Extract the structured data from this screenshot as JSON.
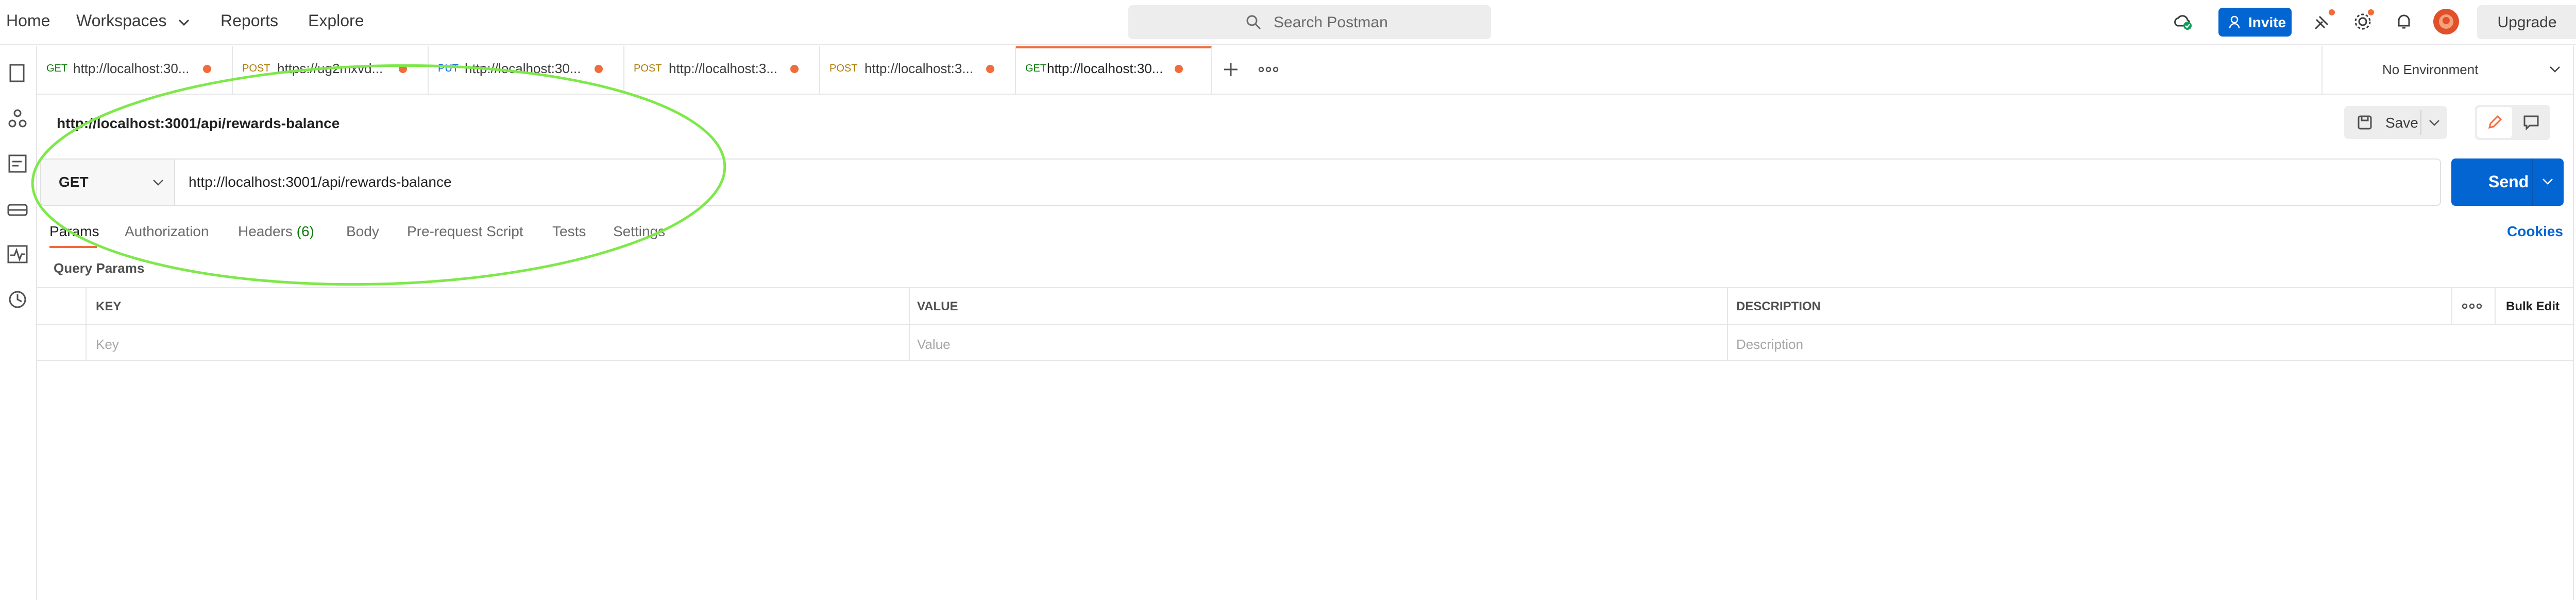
{
  "header": {
    "nav": [
      "Home",
      "Workspaces",
      "Reports",
      "Explore"
    ],
    "search_placeholder": "Search Postman",
    "invite_label": "Invite",
    "upgrade_label": "Upgrade",
    "icons": [
      "cloud-sync-icon",
      "satellite-icon",
      "gear-icon",
      "bell-icon",
      "avatar"
    ]
  },
  "sidebar": {
    "icons": [
      "collections-icon",
      "apis-icon",
      "environments-icon",
      "mock-servers-icon",
      "monitors-icon",
      "history-icon"
    ]
  },
  "tabs": [
    {
      "method": "GET",
      "url": "http://localhost:30...",
      "method_color": "#0f7b0f"
    },
    {
      "method": "POST",
      "url": "https://ug2mxvd...",
      "method_color": "#ad7a03"
    },
    {
      "method": "PUT",
      "url": "http://localhost:30...",
      "method_color": "#0265d2"
    },
    {
      "method": "POST",
      "url": "http://localhost:3...",
      "method_color": "#ad7a03"
    },
    {
      "method": "POST",
      "url": "http://localhost:3...",
      "method_color": "#ad7a03"
    },
    {
      "method": "GET",
      "url": "http://localhost:30...",
      "method_color": "#0f7b0f"
    }
  ],
  "environment": "No Environment",
  "request": {
    "title": "http://localhost:3001/api/rewards-balance",
    "save_label": "Save",
    "method": "GET",
    "url": "http://localhost:3001/api/rewards-balance",
    "send_label": "Send"
  },
  "subtabs": {
    "params": "Params",
    "authorization": "Authorization",
    "headers": "Headers",
    "headers_count": "(6)",
    "body": "Body",
    "pre_request": "Pre-request Script",
    "tests": "Tests",
    "settings": "Settings",
    "cookies": "Cookies"
  },
  "query_params": {
    "label": "Query Params",
    "columns": [
      "KEY",
      "VALUE",
      "DESCRIPTION"
    ],
    "bulk_edit": "Bulk Edit",
    "placeholders": [
      "Key",
      "Value",
      "Description"
    ]
  },
  "colors": {
    "accent": "#f26b3a",
    "primary": "#0265d2",
    "annotation": "#7ee84a"
  }
}
